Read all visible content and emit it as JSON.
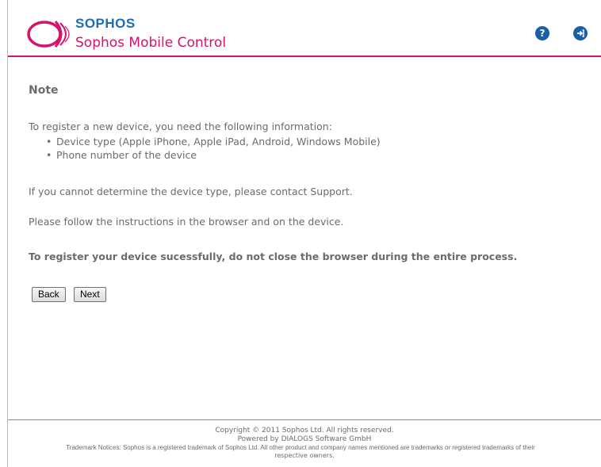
{
  "header": {
    "brand": "SOPHOS",
    "product": "Sophos Mobile Control",
    "help_icon": "help-icon",
    "logout_icon": "logout-icon",
    "accent_color": "#d6126c",
    "brand_color": "#1a6fb4"
  },
  "main": {
    "title": "Note",
    "intro": "To register a new device, you need the following information:",
    "requirements": [
      "Device type (Apple iPhone, Apple iPad, Android, Windows Mobile)",
      "Phone number of the device"
    ],
    "support_text": "If you cannot determine the device type, please contact Support.",
    "instructions": "Please follow the instructions in the browser and on the device.",
    "warning": "To register your device sucessfully, do not close the browser during the entire process.",
    "back_label": "Back",
    "next_label": "Next"
  },
  "footer": {
    "copyright": "Copyright © 2011 Sophos Ltd. All rights reserved.",
    "powered_by": "Powered by DIALOGS Software GmbH",
    "trademark": "Trademark Notices: Sophos is a registered trademark of Sophos Ltd. All other product and company names mentioned are trademarks or registered trademarks of their",
    "trademark_cont": "respective owners."
  }
}
